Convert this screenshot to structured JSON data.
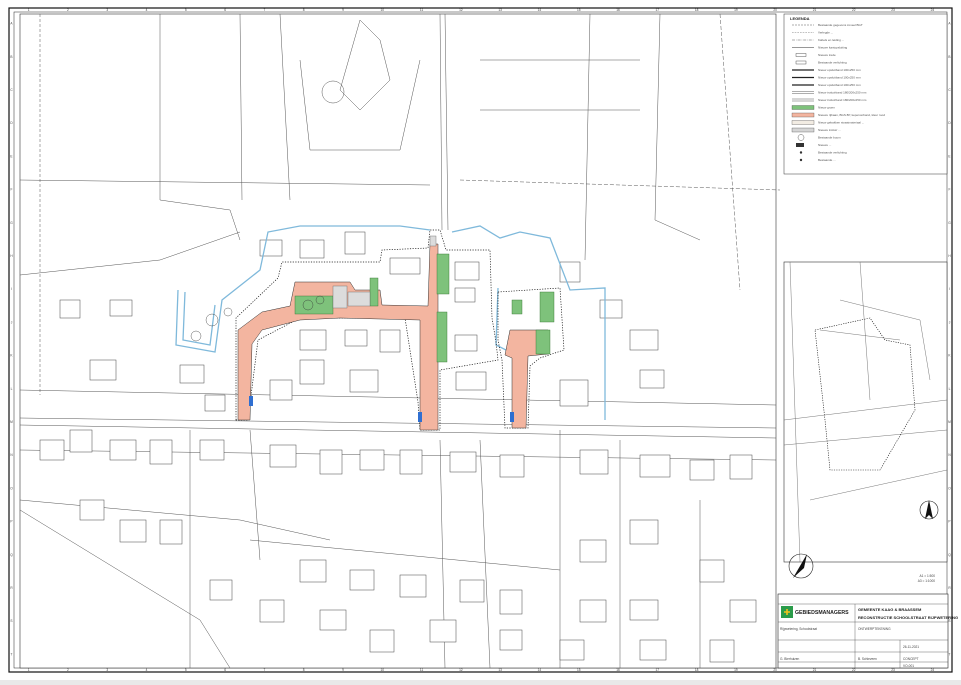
{
  "legend": {
    "title": "LEGENDA",
    "items": [
      {
        "label": "Bestaande gegevens zoveel BGT",
        "kind": "line-dash"
      },
      {
        "label": "Verlegde ...",
        "kind": "line-dot"
      },
      {
        "label": "Kabels en leiding ...",
        "kind": "line-dashdot"
      },
      {
        "label": "Nieuwe kantopsluiting",
        "kind": "line-solid"
      },
      {
        "label": "Nieuwe trede",
        "kind": "box"
      },
      {
        "label": "Bestaande verlichting",
        "kind": "box"
      },
      {
        "label": "Nieuw opsluitband 100x250 mm",
        "kind": "line-thick"
      },
      {
        "label": "Nieuw opsluitband 100x250 mm",
        "kind": "line-thick"
      },
      {
        "label": "Nieuw opsluitband 100x250 mm",
        "kind": "line-thick"
      },
      {
        "label": "Nieuw trottoirband 180/200x250 mm",
        "kind": "line-double"
      },
      {
        "label": "Nieuw trottoirband 180/200x250 mm",
        "kind": "line-double"
      },
      {
        "label": "Nieuw groen",
        "kind": "fill-green"
      },
      {
        "label": "Nieuwe rijbaan, BGS 8P, keperverband, kleur rood",
        "kind": "fill-salmon"
      },
      {
        "label": "Nieuw gebakken straatmateriaal ...",
        "kind": "fill-light"
      },
      {
        "label": "Nieuwe trottoir ...",
        "kind": "fill-grey"
      },
      {
        "label": "Bestaande boom",
        "kind": "tree"
      },
      {
        "label": "Nieuwe ... ",
        "kind": "fill-dark"
      },
      {
        "label": "Bestaande verlichting",
        "kind": "dot"
      },
      {
        "label": "Bestaande ...",
        "kind": "dot"
      }
    ]
  },
  "title_block": {
    "company": "GEBIEDSMANAGERS",
    "client": "GEMEENTE KAAG & BRAASSEM",
    "project": "RECONSTRUCTIE SCHOOLSTRAAT RIJPWETERING",
    "sheet_type": "ONTWERPTEKENING",
    "date": "26-11-2021",
    "author": "G. Bierhuizen",
    "checker": "B. Schieveen",
    "status": "CONCEPT",
    "drawing_no": "VO-001",
    "location": "Rijpwetering, Schoolstraat"
  },
  "colors": {
    "road": "#f3b5a0",
    "green": "#7ec27b",
    "water": "#7fb9db",
    "grid": "#111111"
  },
  "grid": {
    "columns": [
      "1",
      "2",
      "3",
      "4",
      "5",
      "6",
      "7",
      "8",
      "9",
      "10",
      "11",
      "12",
      "13",
      "14",
      "15",
      "16",
      "17",
      "18",
      "19",
      "20",
      "21",
      "22",
      "23",
      "24"
    ],
    "rows": [
      "A",
      "B",
      "C",
      "D",
      "E",
      "F",
      "G",
      "H",
      "I",
      "J",
      "K",
      "L",
      "M",
      "N",
      "O",
      "P",
      "Q",
      "R",
      "S",
      "T"
    ]
  },
  "scale_notes": [
    "A1 = 1:500",
    "A3 = 1:1000"
  ],
  "north_label": "N"
}
